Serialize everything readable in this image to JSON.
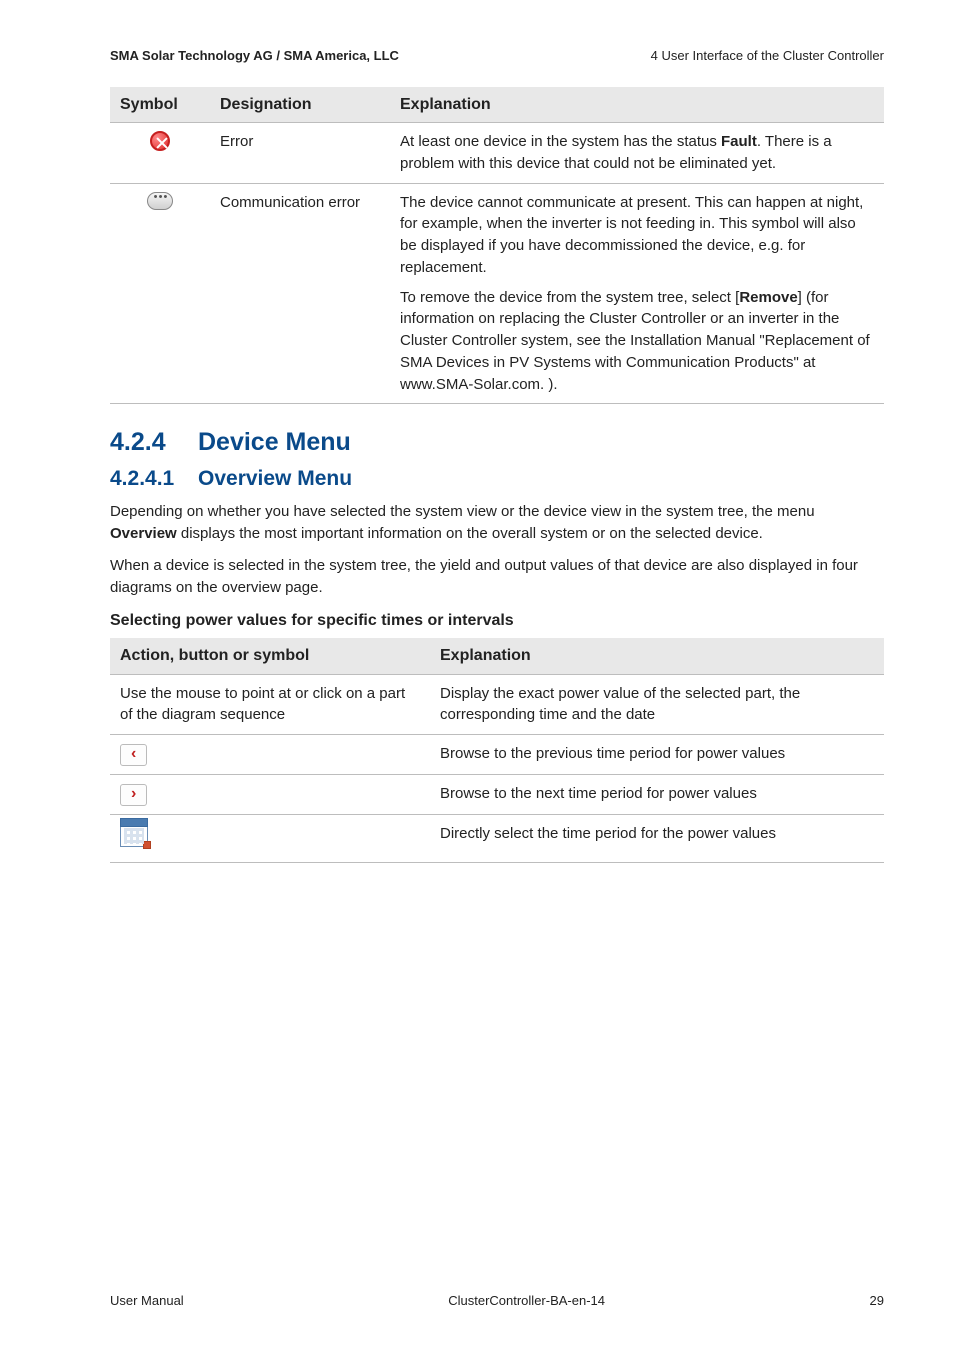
{
  "header": {
    "left": "SMA Solar Technology AG / SMA America, LLC",
    "right": "4 User Interface of the Cluster Controller"
  },
  "symbol_table": {
    "headers": {
      "symbol": "Symbol",
      "designation": "Designation",
      "explanation": "Explanation"
    },
    "rows": [
      {
        "designation": "Error",
        "explanation_parts": [
          "At least one device in the system has the status ",
          "Fault",
          ". There is a problem with this device that could not be eliminated yet."
        ]
      },
      {
        "designation": "Communication error",
        "explanation_p1": "The device cannot communicate at present. This can happen at night, for example, when the inverter is not feeding in. This symbol will also be displayed if you have decommissioned the device, e.g. for replacement.",
        "explanation_p2_parts": [
          "To remove the device from the system tree, select [",
          "Remove",
          "] (for information on replacing the Cluster Controller or an inverter in the Cluster Controller system, see the Installation Manual \"Replacement of SMA Devices in PV Systems with Communication Products\" at www.SMA-Solar.com. )."
        ]
      }
    ]
  },
  "section": {
    "num": "4.2.4",
    "title": "Device Menu"
  },
  "subsection": {
    "num": "4.2.4.1",
    "title": "Overview Menu"
  },
  "paragraphs": {
    "p1_parts": [
      "Depending on whether you have selected the system view or the device view in the system tree, the menu ",
      "Overview",
      " displays the most important information on the overall system or on the selected device."
    ],
    "p2": "When a device is selected in the system tree, the yield and output values of that device are also displayed in four diagrams on the overview page."
  },
  "subhead": "Selecting power values for specific times or intervals",
  "action_table": {
    "headers": {
      "action": "Action, button or symbol",
      "explanation": "Explanation"
    },
    "rows": [
      {
        "action": "Use the mouse to point at or click on a part of the diagram sequence",
        "explanation": "Display the exact power value of the selected part, the corresponding time and the date"
      },
      {
        "explanation": "Browse to the previous time period for power values"
      },
      {
        "explanation": "Browse to the next time period for power values"
      },
      {
        "explanation": "Directly select the time period for the power values"
      }
    ]
  },
  "footer": {
    "left": "User Manual",
    "center": "ClusterController-BA-en-14",
    "right": "29"
  }
}
